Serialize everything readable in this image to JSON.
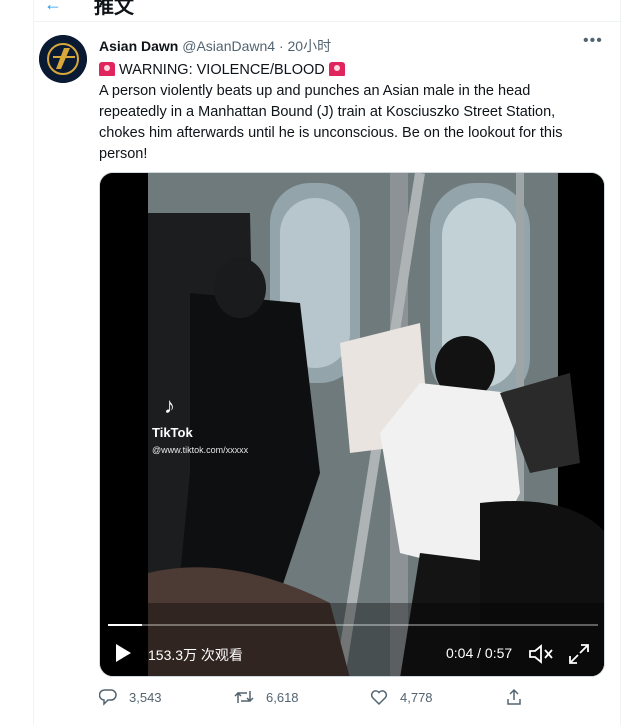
{
  "top_bar": {
    "title": "推文",
    "back_icon": "back-arrow-icon"
  },
  "tweet": {
    "display_name": "Asian Dawn",
    "handle": "@AsianDawn4",
    "separator": "·",
    "time": "20小时",
    "warning": "WARNING: VIOLENCE/BLOOD",
    "body": "A person violently beats up and punches an Asian male in the head repeatedly in a Manhattan Bound (J) train at Kosciuszko Street Station, chokes him afterwards until he is unconscious. Be on the lookout for this person!"
  },
  "video": {
    "watermark": "TikTok",
    "watermark_url": "@www.tiktok.com/xxxxx",
    "views": "153.3万 次观看",
    "timecode": "0:04 / 0:57",
    "progress": 0.07
  },
  "actions": {
    "replies": "3,543",
    "retweets": "6,618",
    "likes": "4,778"
  },
  "colors": {
    "accent": "#1d9bf0",
    "muted": "#536471"
  }
}
